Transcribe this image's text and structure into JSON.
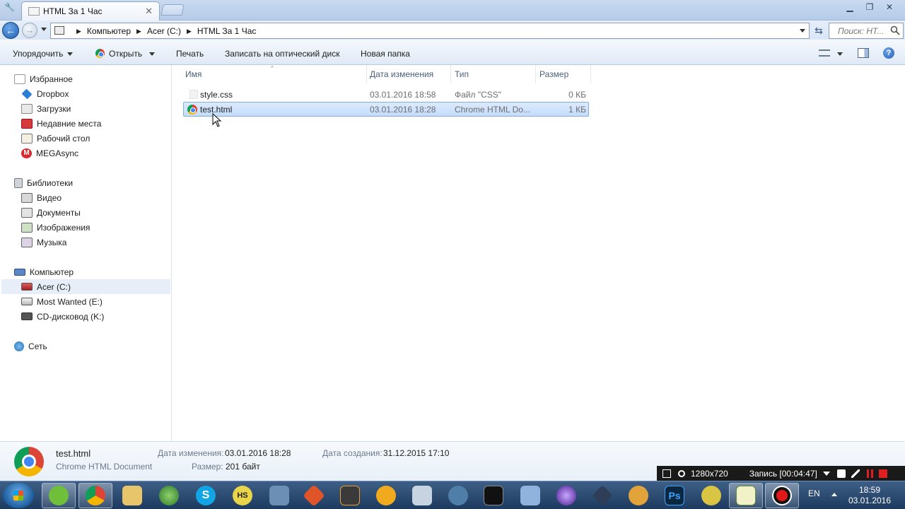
{
  "window": {
    "tab_title": "HTML За 1 Час"
  },
  "address": {
    "crumbs": [
      "Компьютер",
      "Acer (C:)",
      "HTML За 1 Час"
    ],
    "search_placeholder": "Поиск: HT..."
  },
  "toolbar": {
    "organize": "Упорядочить",
    "open": "Открыть",
    "print": "Печать",
    "burn": "Записать на оптический диск",
    "new_folder": "Новая папка"
  },
  "nav": {
    "favorites": "Избранное",
    "dropbox": "Dropbox",
    "downloads": "Загрузки",
    "recent": "Недавние места",
    "desktop": "Рабочий стол",
    "mega": "MEGAsync",
    "libraries": "Библиотеки",
    "video": "Видео",
    "documents": "Документы",
    "pictures": "Изображения",
    "music": "Музыка",
    "computer": "Компьютер",
    "drive_c": "Acer (C:)",
    "drive_e": "Most Wanted (E:)",
    "drive_k": "CD-дисковод (K:)",
    "network": "Сеть"
  },
  "columns": {
    "name": "Имя",
    "modified": "Дата изменения",
    "type": "Тип",
    "size": "Размер"
  },
  "files": [
    {
      "name": "style.css",
      "modified": "03.01.2016 18:58",
      "type": "Файл \"CSS\"",
      "size": "0 КБ"
    },
    {
      "name": "test.html",
      "modified": "03.01.2016 18:28",
      "type": "Chrome HTML Do...",
      "size": "1 КБ"
    }
  ],
  "details": {
    "name": "test.html",
    "kind": "Chrome HTML Document",
    "modified_label": "Дата изменения:",
    "modified_value": "03.01.2016 18:28",
    "size_label": "Размер:",
    "size_value": "201 байт",
    "created_label": "Дата создания:",
    "created_value": "31.12.2015 17:10"
  },
  "recorder": {
    "resolution": "1280x720",
    "recording": "Запись [00:04:47]"
  },
  "taskbar": {
    "lang": "EN",
    "time": "18:59",
    "date": "03.01.2016",
    "hs_label": "HS",
    "ps_label": "Ps"
  },
  "colors": {
    "selection": "#cce0fb",
    "accent": "#1f5fb6",
    "taskbar": "#2a4a72"
  }
}
